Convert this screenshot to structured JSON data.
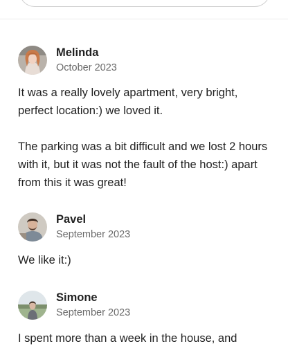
{
  "reviews": [
    {
      "name": "Melinda",
      "date": "October 2023",
      "paragraphs": [
        "It was a really lovely apartment, very bright, perfect location:) we loved it.",
        "The parking was a bit difficult and we lost 2 hours with it, but it was not the fault of the host:) apart from this it was great!"
      ]
    },
    {
      "name": "Pavel",
      "date": "September 2023",
      "paragraphs": [
        "We like it:)"
      ]
    },
    {
      "name": "Simone",
      "date": "September 2023",
      "paragraphs": [
        "I spent more than a week in the house, and"
      ]
    }
  ]
}
